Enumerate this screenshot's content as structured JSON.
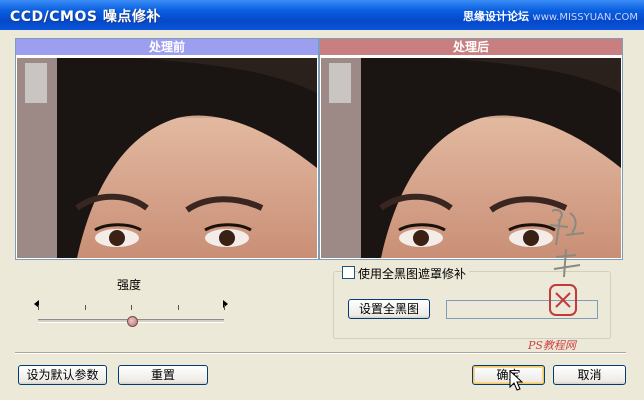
{
  "window": {
    "title": "CCD/CMOS 噪点修补",
    "watermark": {
      "main": "思缘设计论坛",
      "site": "www.MISSYUAN.COM"
    }
  },
  "panels": {
    "before": {
      "label": "处理前"
    },
    "after": {
      "label": "处理后"
    }
  },
  "strength": {
    "label": "强度",
    "value_fraction": 0.51
  },
  "mask_group": {
    "checkbox_label": "使用全黑图遮罩修补",
    "checked": false,
    "set_black_button": "设置全黑图",
    "path_value": ""
  },
  "buttons": {
    "set_default": "设为默认参数",
    "reset": "重置",
    "ok": "确定",
    "cancel": "取消"
  },
  "footer_watermark": "PS教程网",
  "colors": {
    "titlebar": "#0a5fe0",
    "before_header": "#9c9ef0",
    "after_header": "#c97f7f",
    "dialog_bg": "#ece9d8"
  },
  "icons": {
    "cursor": "arrow-cursor-icon",
    "slider_left": "triangle-left-icon",
    "slider_right": "triangle-right-icon"
  }
}
